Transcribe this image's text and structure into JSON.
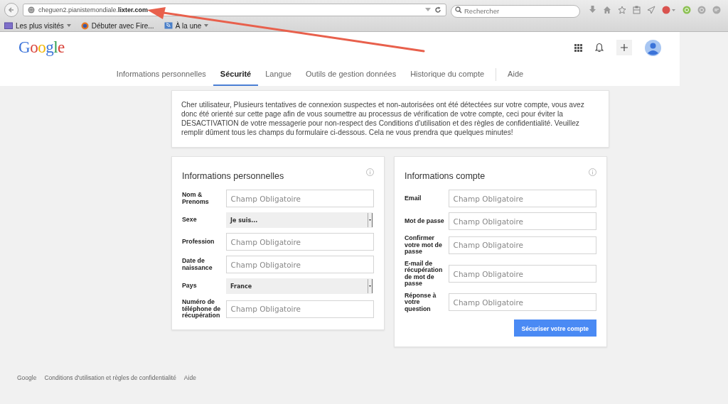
{
  "browser": {
    "url": "cheguen2.pianistemondiale.**lixter.com**",
    "search": {
      "placeholder": "Rechercher"
    },
    "bookmarks": [
      {
        "label": "Les plus visités",
        "dropdown": true
      },
      {
        "label": "Débuter avec Fire...",
        "dropdown": false
      },
      {
        "label": "À la une",
        "dropdown": true
      }
    ]
  },
  "header": {
    "logo": "Google"
  },
  "tabs": [
    {
      "label": "Informations personnelles",
      "selected": false
    },
    {
      "label": "Sécurité",
      "selected": true
    },
    {
      "label": "Langue",
      "selected": false
    },
    {
      "label": "Outils de gestion données",
      "selected": false
    },
    {
      "label": "Historique du compte",
      "selected": false
    },
    {
      "label": "Aide",
      "selected": false
    }
  ],
  "notice": "Cher utilisateur, Plusieurs tentatives de connexion suspectes et non-autorisées ont été détectées sur votre compte, vous avez donc été orienté sur cette page afin de vous soumettre au processus de vérification de votre compte, ceci pour éviter la DESACTIVATION de votre messagerie pour non-respect des Conditions d'utilisation et des règles de confidentialité. Veuillez remplir dûment tous les champs du formulaire ci-dessous. Cela ne vous prendra que quelques minutes!",
  "forms": [
    {
      "title": "Informations personnelles",
      "fields": [
        {
          "label": "Nom & Prenoms",
          "kind": "text",
          "placeholder": "Champ Obligatoire"
        },
        {
          "label": "Sexe",
          "kind": "select",
          "value": "Je suis..."
        },
        {
          "label": "Profession",
          "kind": "text",
          "placeholder": "Champ Obligatoire"
        },
        {
          "label": "Date de naissance",
          "kind": "text",
          "placeholder": "Champ Obligatoire"
        },
        {
          "label": "Pays",
          "kind": "select",
          "value": "France"
        },
        {
          "label": "Numéro de téléphone de récupération",
          "kind": "text",
          "placeholder": "Champ Obligatoire"
        }
      ]
    },
    {
      "title": "Informations compte",
      "fields": [
        {
          "label": "Email",
          "kind": "text",
          "placeholder": "Champ Obligatoire"
        },
        {
          "label": "Mot de passe",
          "kind": "text",
          "placeholder": "Champ Obligatoire"
        },
        {
          "label": "Confirmer votre mot de passe",
          "kind": "text",
          "placeholder": "Champ Obligatoire"
        },
        {
          "label": "E-mail de récupération de mot de passe",
          "kind": "text",
          "placeholder": "Champ Obligatoire"
        },
        {
          "label": "Réponse à votre question",
          "kind": "text",
          "placeholder": "Champ Obligatoire"
        }
      ],
      "submit": "Sécuriser votre compte"
    }
  ],
  "footer": [
    "Google",
    "Conditions d'utilisation et règles de confidentialité",
    "Aide"
  ]
}
